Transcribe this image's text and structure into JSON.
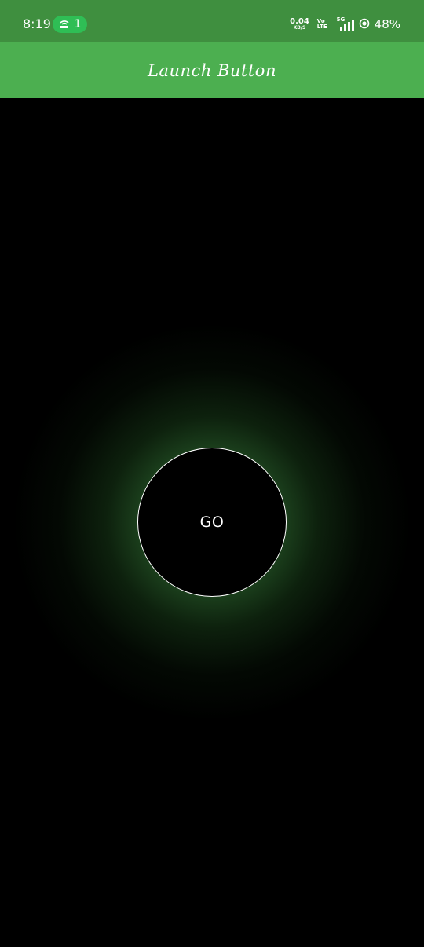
{
  "status_bar": {
    "time": "8:19",
    "hotspot_count": "1",
    "net_speed_value": "0.04",
    "net_speed_unit": "KB/S",
    "volte_top": "Vo",
    "volte_bottom": "LTE",
    "network_type": "5G",
    "battery": "48%",
    "icons": [
      "hotspot-icon",
      "signal-icon",
      "battery-icon"
    ]
  },
  "app_bar": {
    "title": "Launch Button"
  },
  "launch": {
    "button_label": "GO",
    "glow_color": "#4caf50",
    "border_color": "#ffffff"
  },
  "colors": {
    "status_bar": "#3f8f3f",
    "app_bar": "#4caf50",
    "background": "#000000",
    "hotspot_pill": "#2fbe55"
  }
}
